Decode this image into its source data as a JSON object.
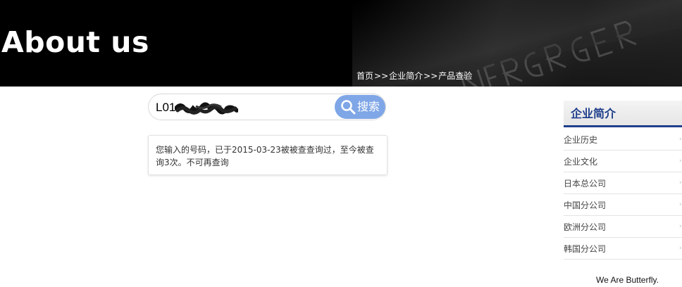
{
  "banner": {
    "title": "About us",
    "breadcrumb": [
      {
        "label": "首页"
      },
      {
        "label": "企业简介"
      },
      {
        "label": "产品查验"
      }
    ],
    "separator": ">>"
  },
  "search": {
    "value": "L01",
    "button_label": "搜索",
    "button_color": "#7fa6e6"
  },
  "result": {
    "message": "您输入的号码，已于2015-03-23被被查查询过，至今被查询3次。不可再查询"
  },
  "sidebar": {
    "title": "企业简介",
    "accent_color": "#1f3f8c",
    "items": [
      {
        "label": "企业历史"
      },
      {
        "label": "企业文化"
      },
      {
        "label": "日本总公司"
      },
      {
        "label": "中国分公司"
      },
      {
        "label": "欧洲分公司"
      },
      {
        "label": "韩国分公司"
      }
    ]
  },
  "footer": {
    "tagline": "We Are Butterfly."
  }
}
